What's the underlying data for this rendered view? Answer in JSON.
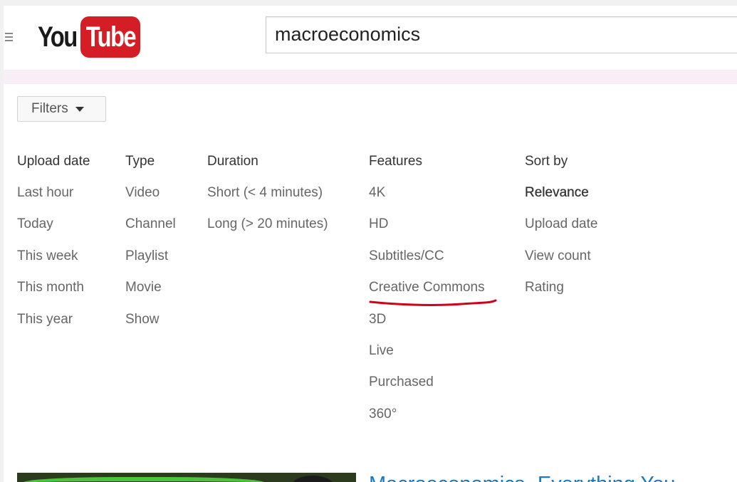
{
  "header": {
    "logo_you": "You",
    "logo_tube": "Tube",
    "search_value": "macroeconomics"
  },
  "filters": {
    "button_label": "Filters",
    "columns": [
      {
        "heading": "Upload date",
        "items": [
          "Last hour",
          "Today",
          "This week",
          "This month",
          "This year"
        ]
      },
      {
        "heading": "Type",
        "items": [
          "Video",
          "Channel",
          "Playlist",
          "Movie",
          "Show"
        ]
      },
      {
        "heading": "Duration",
        "items": [
          "Short (< 4 minutes)",
          "Long (> 20 minutes)"
        ]
      },
      {
        "heading": "Features",
        "items": [
          "4K",
          "HD",
          "Subtitles/CC",
          "Creative Commons",
          "3D",
          "Live",
          "Purchased",
          "360°"
        ]
      },
      {
        "heading": "Sort by",
        "items": [
          "Relevance",
          "Upload date",
          "View count",
          "Rating"
        ]
      }
    ],
    "selected_sort": "Relevance"
  },
  "annotation": {
    "color": "#d0021b"
  },
  "result": {
    "title": "Macroeconomics- Everything You"
  }
}
